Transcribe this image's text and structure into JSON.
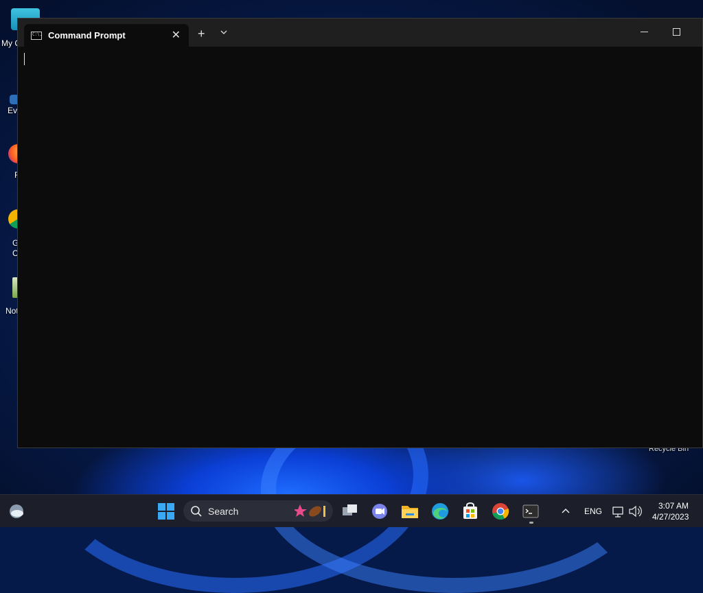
{
  "desktop": {
    "icons": [
      {
        "label": "My C",
        "name": "desktop-icon-my-computer"
      },
      {
        "label": "Eve",
        "name": "desktop-icon-everything"
      },
      {
        "label": "F",
        "name": "desktop-icon-firefox"
      },
      {
        "label": "G\nC",
        "name": "desktop-icon-google-chrome"
      },
      {
        "label": "Not",
        "name": "desktop-icon-notepad"
      }
    ],
    "recycle_bin_label": "Recycle Bin"
  },
  "window": {
    "tab_title": "Command Prompt",
    "tab_close_glyph": "✕",
    "new_tab_glyph": "+",
    "icon_text": "C:\\."
  },
  "taskbar": {
    "search_placeholder": "Search",
    "tray": {
      "language": "ENG",
      "time": "3:07 AM",
      "date": "4/27/2023"
    },
    "apps": [
      "widgets",
      "start",
      "search",
      "task-view",
      "teams-chat",
      "file-explorer",
      "edge",
      "store",
      "chrome",
      "terminal"
    ]
  },
  "colors": {
    "terminal_bg": "#0c0c0c",
    "titlebar_bg": "#1f1f1f",
    "taskbar_bg": "#1c1f2a",
    "accent_blue": "#1e6cff"
  }
}
